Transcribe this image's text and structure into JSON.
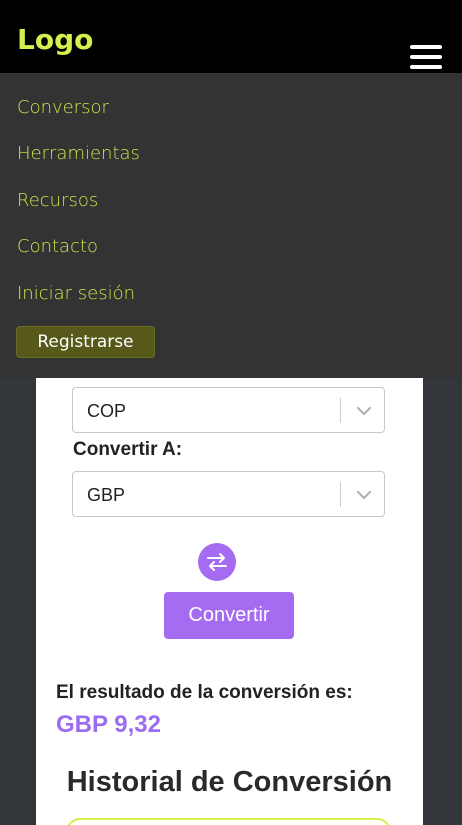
{
  "header": {
    "logo": "Logo",
    "menu_icon": "hamburger-menu-icon"
  },
  "nav": {
    "items": [
      {
        "label": "Conversor"
      },
      {
        "label": "Herramientas"
      },
      {
        "label": "Recursos"
      },
      {
        "label": "Contacto"
      },
      {
        "label": "Iniciar sesión"
      }
    ],
    "register_label": "Registrarse"
  },
  "converter": {
    "from_currency": "COP",
    "to_label": "Convertir A:",
    "to_currency": "GBP",
    "dropdown_icon": "chevron-down-icon",
    "swap_icon": "swap-arrows-icon",
    "convert_label": "Convertir"
  },
  "result": {
    "label": "El resultado de la conversión es:",
    "value": "GBP 9,32"
  },
  "history": {
    "title": "Historial de Conversión"
  },
  "colors": {
    "accent_lime": "#d4f04b",
    "accent_purple": "#a56cf2",
    "header_bg": "#000000",
    "nav_bg": "#333333"
  }
}
